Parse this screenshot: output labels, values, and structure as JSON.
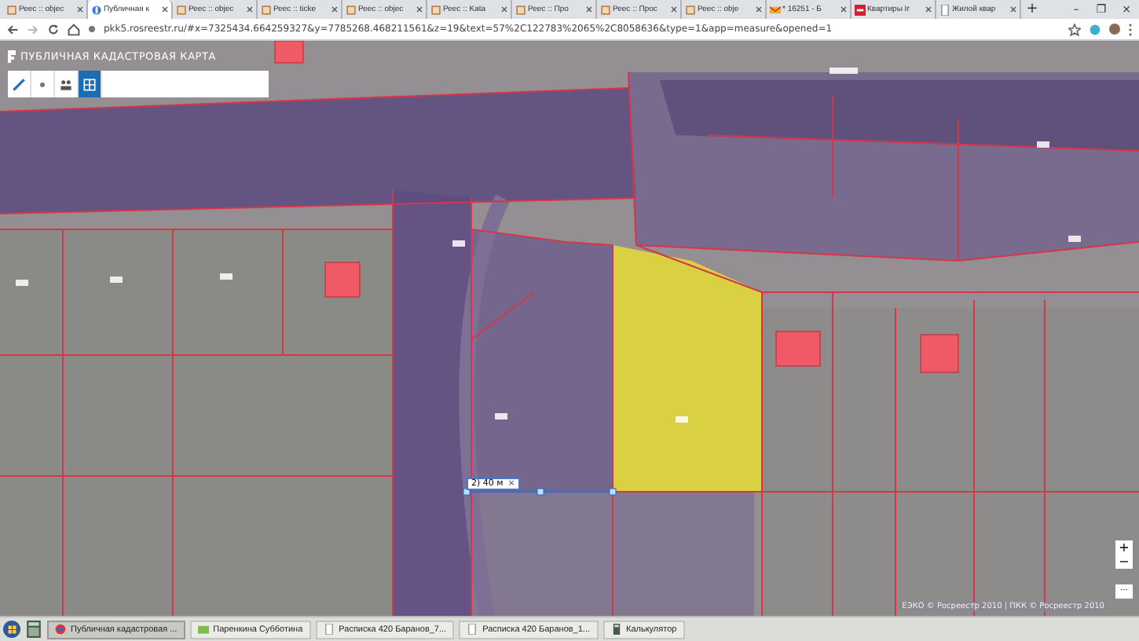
{
  "browser": {
    "tabs": [
      {
        "title": "Реес :: objec",
        "kind": "doc",
        "selected": false
      },
      {
        "title": "Публичная к",
        "kind": "map",
        "selected": true
      },
      {
        "title": "Реес :: objec",
        "kind": "doc",
        "selected": false
      },
      {
        "title": "Реес :: ticke",
        "kind": "doc",
        "selected": false
      },
      {
        "title": "Реес :: objec",
        "kind": "doc",
        "selected": false
      },
      {
        "title": "Реес :: Kata",
        "kind": "doc",
        "selected": false
      },
      {
        "title": "Реес :: Про",
        "kind": "doc",
        "selected": false
      },
      {
        "title": "Реес :: Прос",
        "kind": "doc",
        "selected": false
      },
      {
        "title": "Реес :: obje",
        "kind": "doc",
        "selected": false
      },
      {
        "title": "* 16251 - Б",
        "kind": "mail",
        "selected": false
      },
      {
        "title": "Квартиры Ir",
        "kind": "red",
        "selected": false
      },
      {
        "title": "Жилой квар",
        "kind": "page",
        "selected": false
      }
    ],
    "new_tab": "+",
    "window_controls": [
      "–",
      "❐",
      "×"
    ],
    "address": "pkk5.rosreestr.ru/#x=7325434.664259327&y=7785268.468211561&z=19&text=57%2C122783%2065%2C8058636&type=1&app=measure&opened=1"
  },
  "map": {
    "title": "ПУБЛИЧНАЯ КАДАСТРОВАЯ КАРТА",
    "tools": [
      {
        "kind": "ruler",
        "selected": false
      },
      {
        "kind": "dot",
        "selected": false
      },
      {
        "kind": "people",
        "selected": false
      },
      {
        "kind": "grid",
        "selected": true
      }
    ],
    "measure": {
      "label": "2) 40 м",
      "close": "×"
    },
    "zoom": {
      "in": "+",
      "out": "−",
      "more": "···"
    },
    "attribution": "ЕЭКО © Росреестр 2010 | ПКК © Росреестр 2010"
  },
  "taskbar": {
    "items": [
      {
        "label": "Публичная кадастровая ...",
        "kind": "browser",
        "selected": true
      },
      {
        "label": "Паренкина Субботина",
        "kind": "folder",
        "selected": false
      },
      {
        "label": "Расписка 420 Баранов_7...",
        "kind": "doc",
        "selected": false
      },
      {
        "label": "Расписка 420 Баранов_1...",
        "kind": "doc",
        "selected": false
      },
      {
        "label": "Калькулятор",
        "kind": "calc",
        "selected": false
      }
    ]
  }
}
